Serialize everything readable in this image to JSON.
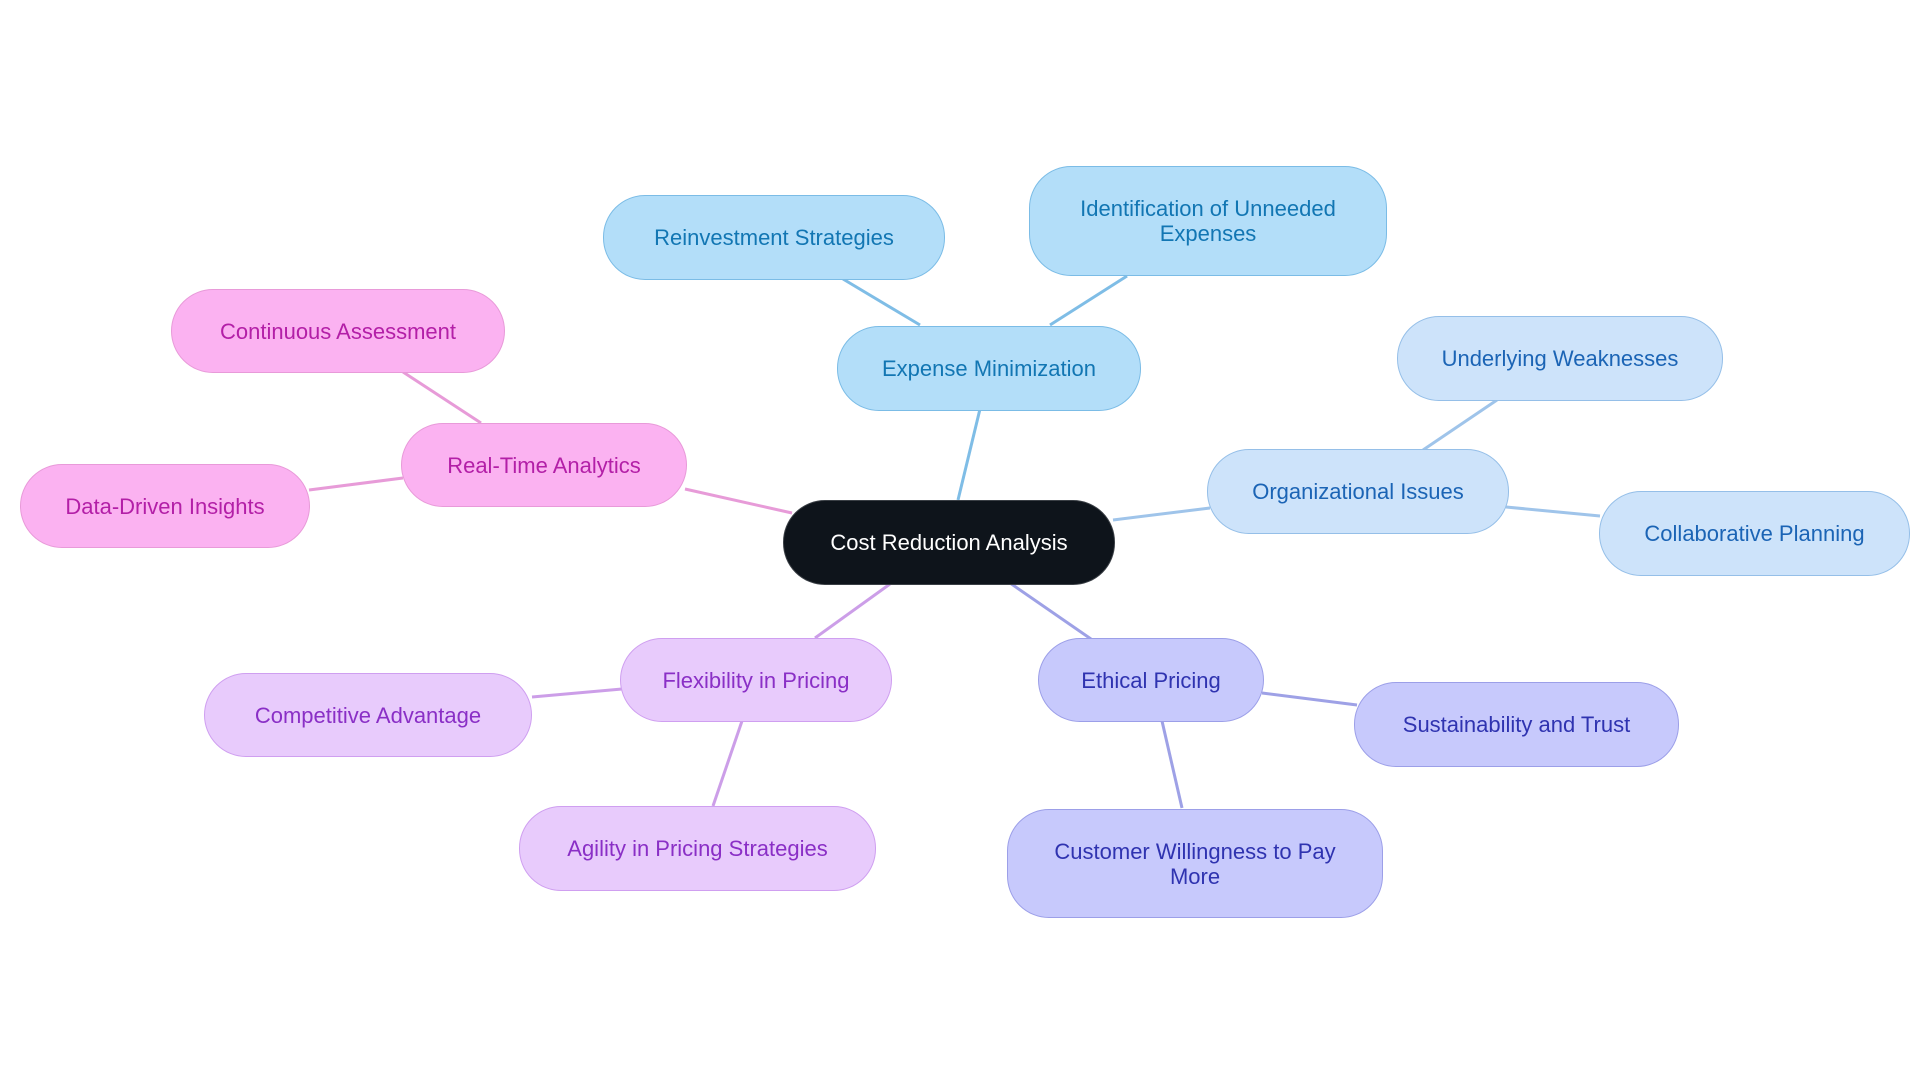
{
  "diagram": {
    "type": "mindmap",
    "root": {
      "id": "root",
      "label": "Cost Reduction Analysis"
    },
    "branches": [
      {
        "id": "expense",
        "label": "Expense Minimization",
        "palette": "sky",
        "edge_color": "#7fbde6",
        "children": [
          {
            "id": "reinvest",
            "label": "Reinvestment Strategies"
          },
          {
            "id": "identify",
            "label": "Identification of Unneeded Expenses"
          }
        ]
      },
      {
        "id": "org",
        "label": "Organizational Issues",
        "palette": "lblue",
        "edge_color": "#9fc4ea",
        "children": [
          {
            "id": "weak",
            "label": "Underlying Weaknesses"
          },
          {
            "id": "collab",
            "label": "Collaborative Planning"
          }
        ]
      },
      {
        "id": "ethical",
        "label": "Ethical Pricing",
        "palette": "indigo",
        "edge_color": "#9ea1e6",
        "children": [
          {
            "id": "sustain",
            "label": "Sustainability and Trust"
          },
          {
            "id": "willing",
            "label": "Customer Willingness to Pay More"
          }
        ]
      },
      {
        "id": "flex",
        "label": "Flexibility in Pricing",
        "palette": "lilac",
        "edge_color": "#cc9ee8",
        "children": [
          {
            "id": "compet",
            "label": "Competitive Advantage"
          },
          {
            "id": "agility",
            "label": "Agility in Pricing Strategies"
          }
        ]
      },
      {
        "id": "rta",
        "label": "Real-Time Analytics",
        "palette": "pink",
        "edge_color": "#e79bd8",
        "children": [
          {
            "id": "contin",
            "label": "Continuous Assessment"
          },
          {
            "id": "ddi",
            "label": "Data-Driven Insights"
          }
        ]
      }
    ]
  }
}
